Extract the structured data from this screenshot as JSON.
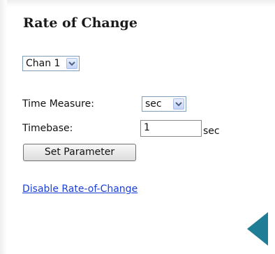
{
  "panel": {
    "title": "Rate of Change"
  },
  "channel_select": {
    "value": "Chan 1"
  },
  "time_measure": {
    "label": "Time Measure:",
    "value": "sec"
  },
  "timebase": {
    "label": "Timebase:",
    "value": "1",
    "unit": "sec"
  },
  "set_parameter_button": {
    "label": "Set Parameter"
  },
  "disable_link": {
    "label": "Disable Rate-of-Change"
  },
  "icons": {
    "dropdown": "chevron-down-icon",
    "back": "back-arrow-icon"
  },
  "colors": {
    "link": "#1a3fd6",
    "back_arrow": "#1f7d96"
  }
}
